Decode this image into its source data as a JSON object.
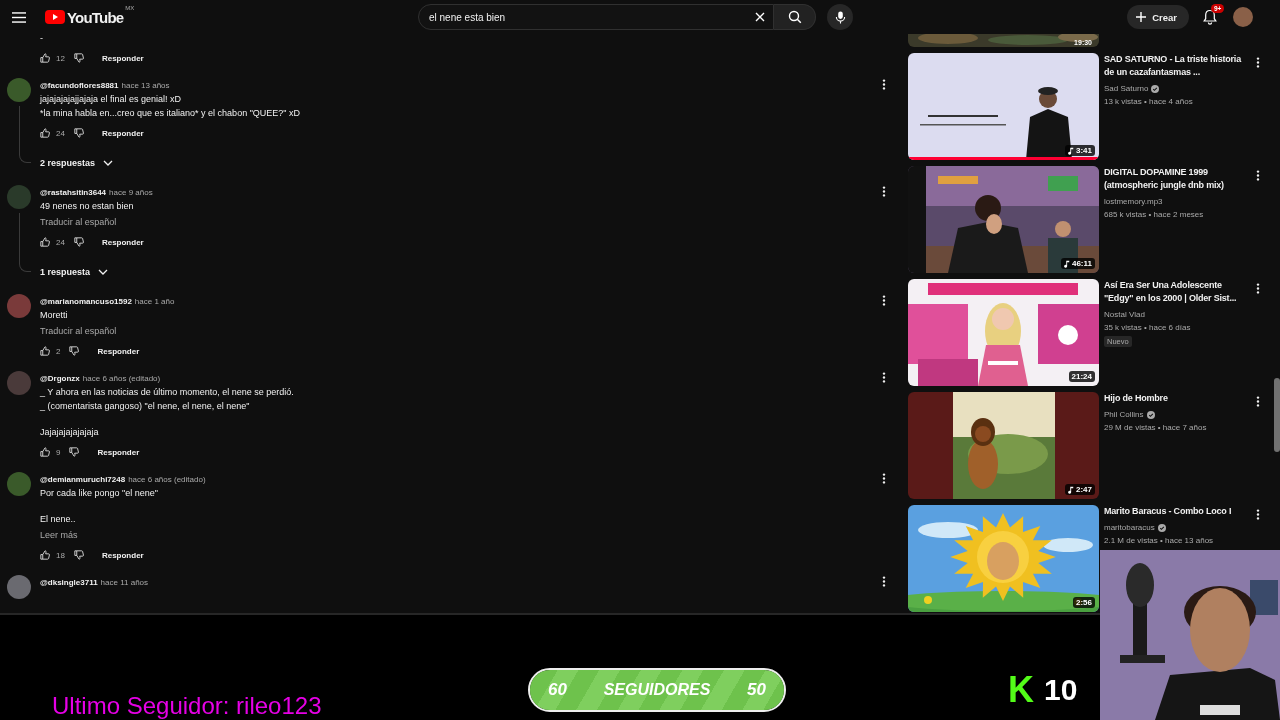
{
  "header": {
    "logo": "YouTube",
    "country": "MX",
    "search": {
      "value": "el nene esta bien"
    },
    "create": "Crear",
    "notifications": "9+"
  },
  "comments": [
    {
      "kind": "comment",
      "paragraphs": [
        [
          "-"
        ]
      ],
      "likes": "12",
      "reply": "Responder"
    },
    {
      "kind": "comment",
      "author": "@facundoflores8881",
      "time": "hace 13 años",
      "paragraphs": [
        [
          "jajajajajajjajaja el final es genial! xD",
          "*la mina habla en...creo que es italiano* y el chabon \"QUEE?\" xD"
        ]
      ],
      "likes": "24",
      "reply": "Responder",
      "thread": true
    },
    {
      "kind": "replies",
      "label": "2 respuestas"
    },
    {
      "kind": "comment",
      "author": "@rastahsitin3644",
      "time": "hace 9 años",
      "paragraphs": [
        [
          "49 nenes no estan bien"
        ]
      ],
      "translate": "Traducir al español",
      "likes": "24",
      "reply": "Responder",
      "thread": true
    },
    {
      "kind": "replies",
      "label": "1 respuesta"
    },
    {
      "kind": "comment",
      "author": "@marianomancuso1592",
      "time": "hace 1 año",
      "paragraphs": [
        [
          "Moretti"
        ]
      ],
      "translate": "Traducir al español",
      "likes": "2",
      "reply": "Responder"
    },
    {
      "kind": "comment",
      "author": "@Drgonzx",
      "time": "hace 6 años (editado)",
      "paragraphs": [
        [
          "_ Y ahora en las noticias de último momento, el nene se perdió.",
          "_ (comentarista gangoso) \"el nene, el nene, el nene\""
        ],
        [
          "Jajajajajajajaja"
        ]
      ],
      "likes": "9",
      "reply": "Responder"
    },
    {
      "kind": "comment",
      "author": "@demianmuruchi7248",
      "time": "hace 6 años (editado)",
      "paragraphs": [
        [
          "Por cada like pongo \"el nene\""
        ],
        [
          "El nene.."
        ]
      ],
      "more": "Leer más",
      "likes": "18",
      "reply": "Responder"
    },
    {
      "kind": "comment",
      "author": "@dksingle3711",
      "time": "hace 11 años"
    }
  ],
  "sidebar": {
    "top_duration": "19:30",
    "videos": [
      {
        "title": "SAD SATURNO -  La triste historia de un cazafantasmas ...",
        "channel": "Sad Saturno",
        "verified": true,
        "meta": "13 k vistas • hace 4 años",
        "duration": "3:41",
        "music": true,
        "level": 1
      },
      {
        "title": "DIGITAL DOPAMINE 1999 (atmospheric jungle dnb mix)",
        "channel": "lostmemory.mp3",
        "verified": false,
        "meta": "685 k vistas • hace 2 meses",
        "duration": "46:11",
        "music": true
      },
      {
        "title": "Así Era Ser Una Adolescente \"Edgy\" en los 2000 | Older Sist...",
        "channel": "Nostal Vlad",
        "verified": false,
        "meta": "35 k vistas • hace 6 días",
        "badge": "Nuevo",
        "duration": "21:24",
        "music": false
      },
      {
        "title": "Hijo de Hombre",
        "channel": "Phil Collins",
        "verified": true,
        "meta": "29 M de vistas • hace 7 años",
        "duration": "2:47",
        "music": true
      },
      {
        "title": "Marito Baracus - Combo Loco I",
        "channel": "maritobaracus",
        "verified": true,
        "meta": "2.1 M de vistas • hace 13 años",
        "duration": "2:56",
        "music": false
      }
    ]
  },
  "overlay": {
    "last_follower": "Ultimo Seguidor: rileo123",
    "goal": {
      "current": "60",
      "label": "SEGUIDORES",
      "target": "50",
      "level": 1
    },
    "kick": {
      "logo": "K",
      "count": "10"
    }
  }
}
